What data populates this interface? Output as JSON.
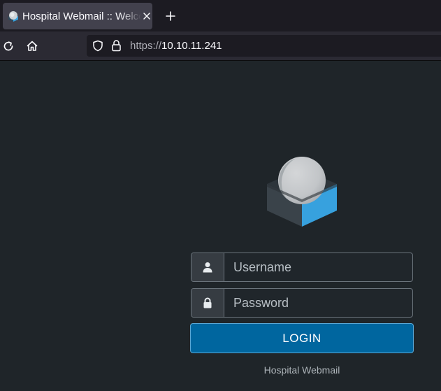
{
  "browser": {
    "tab": {
      "title": "Hospital Webmail :: Welcome to Hospital Webmail",
      "favicon": "roundcube-favicon",
      "close_icon": "close-icon"
    },
    "new_tab_icon": "plus-icon",
    "nav": {
      "reload_icon": "reload-icon",
      "home_icon": "home-icon"
    },
    "urlbar": {
      "shield_icon": "shield-icon",
      "lock_icon": "lock-icon",
      "scheme": "https://",
      "host": "10.10.11.241"
    }
  },
  "page": {
    "logo": "roundcube-logo",
    "login_form": {
      "username": {
        "placeholder": "Username",
        "value": "",
        "icon": "user-icon"
      },
      "password": {
        "placeholder": "Password",
        "value": "",
        "icon": "lock-icon"
      },
      "login_button_label": "LOGIN"
    },
    "footer": "Hospital Webmail"
  },
  "colors": {
    "page_background": "#1f2529",
    "accent": "#00669f",
    "logo_blue": "#37a1de",
    "logo_dark": "#3a434a"
  }
}
